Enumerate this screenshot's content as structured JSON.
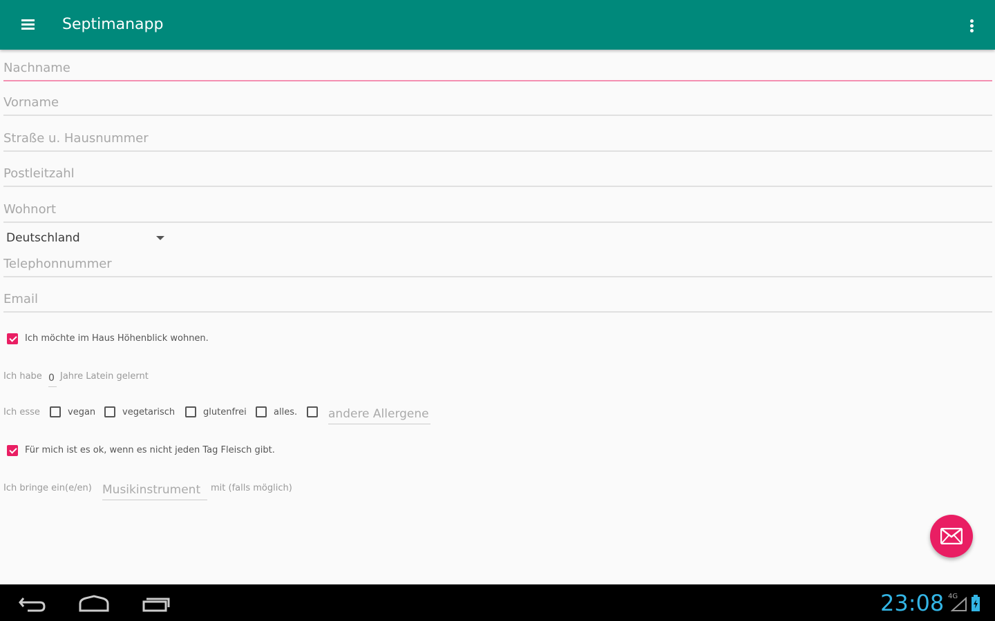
{
  "app": {
    "title": "Septimanapp"
  },
  "form": {
    "lastname_placeholder": "Nachname",
    "firstname_placeholder": "Vorname",
    "street_placeholder": "Straße u. Hausnummer",
    "zip_placeholder": "Postleitzahl",
    "city_placeholder": "Wohnort",
    "country_selected": "Deutschland",
    "phone_placeholder": "Telephonnummer",
    "email_placeholder": "Email",
    "house_checkbox_label": "Ich möchte im Haus Höhenblick wohnen.",
    "latin_prefix": "Ich habe",
    "latin_value": "0",
    "latin_suffix": "Jahre Latein gelernt",
    "diet_prefix": "Ich esse",
    "diet_options": [
      "vegan",
      "vegetarisch",
      "glutenfrei",
      "alles."
    ],
    "allergens_placeholder": "andere Allergene",
    "meat_checkbox_label": "Für mich ist es ok, wenn es nicht jeden Tag Fleisch gibt.",
    "instrument_prefix": "Ich bringe ein(e/en)",
    "instrument_placeholder": "Musikinstrument",
    "instrument_suffix": "mit (falls möglich)"
  },
  "status": {
    "time": "23:08",
    "network": "4G"
  },
  "colors": {
    "appbar": "#00897b",
    "accent": "#e91e63",
    "clock": "#33b5e5"
  }
}
